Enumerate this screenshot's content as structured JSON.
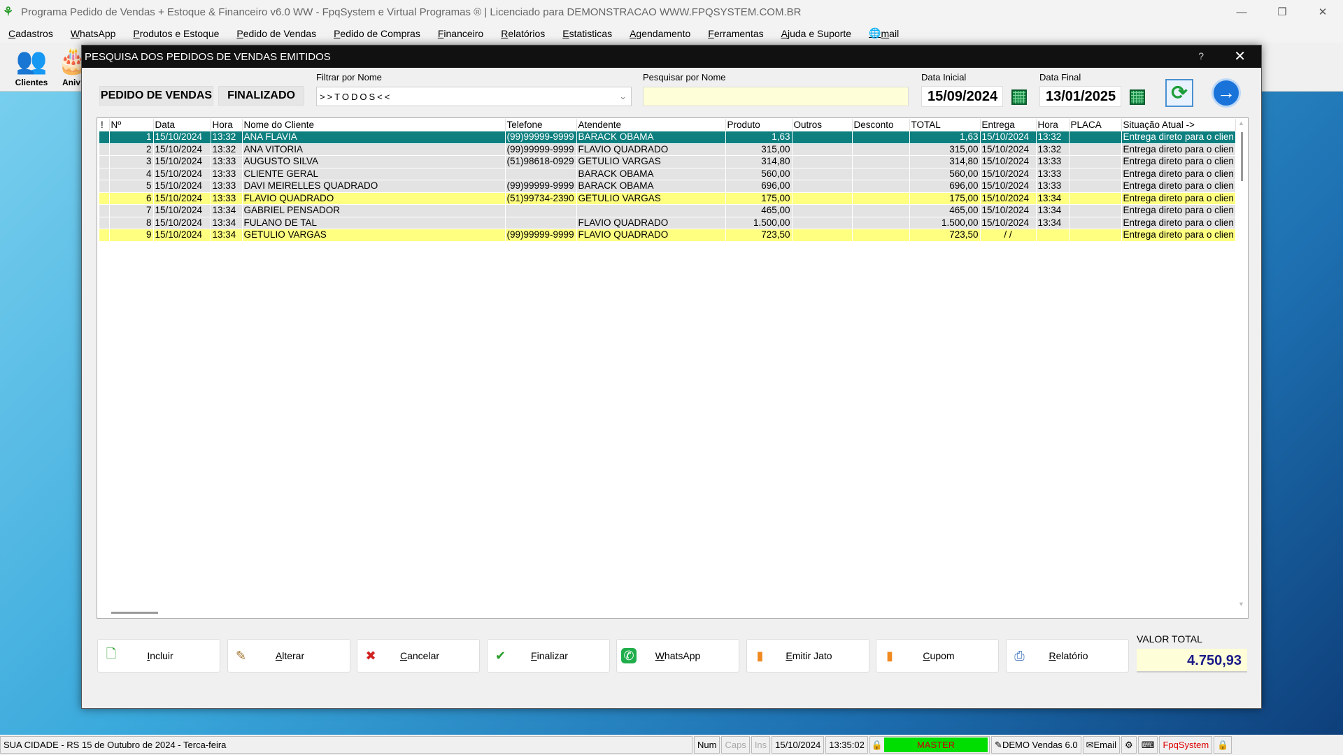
{
  "app": {
    "title": "Programa Pedido de Vendas + Estoque & Financeiro v6.0 WW - FpqSystem e Virtual Programas ® | Licenciado para  DEMONSTRACAO WWW.FPQSYSTEM.COM.BR"
  },
  "menu": [
    "Cadastros",
    "WhatsApp",
    "Produtos e Estoque",
    "Pedido de Vendas",
    "Pedido de Compras",
    "Financeiro",
    "Relatórios",
    "Estatisticas",
    "Agendamento",
    "Ferramentas",
    "Ajuda e Suporte",
    "mail"
  ],
  "toolbar": {
    "clientes": "Clientes",
    "aniversarios": "Aniv"
  },
  "dialog": {
    "title": "PESQUISA DOS PEDIDOS DE VENDAS EMITIDOS",
    "help": "?",
    "tag_pedido": "PEDIDO DE VENDAS",
    "tag_finalizado": "FINALIZADO",
    "filter_label": "Filtrar por Nome",
    "filter_value": ">>TODOS<<",
    "search_label": "Pesquisar por Nome",
    "search_value": "",
    "date_start_label": "Data Inicial",
    "date_start": "15/09/2024",
    "date_end_label": "Data Final",
    "date_end": "13/01/2025",
    "columns": [
      "!",
      "Nº",
      "Data",
      "Hora",
      "Nome do Cliente",
      "Telefone",
      "Atendente",
      "Produto",
      "Outros",
      "Desconto",
      "TOTAL",
      "Entrega",
      "Hora",
      "PLACA",
      "Situação Atual ->"
    ],
    "rows": [
      {
        "n": "1",
        "data": "15/10/2024",
        "hora": "13:32",
        "cliente": "ANA FLAVIA",
        "tel": "(99)99999-9999",
        "atendente": "BARACK OBAMA",
        "produto": "1,63",
        "outros": "",
        "desconto": "",
        "total": "1,63",
        "entrega": "15/10/2024",
        "hora_ent": "13:32",
        "placa": "",
        "situacao": "Entrega direto para o clien",
        "style": "selected"
      },
      {
        "n": "2",
        "data": "15/10/2024",
        "hora": "13:32",
        "cliente": "ANA VITORIA",
        "tel": "(99)99999-9999",
        "atendente": "FLAVIO QUADRADO",
        "produto": "315,00",
        "outros": "",
        "desconto": "",
        "total": "315,00",
        "entrega": "15/10/2024",
        "hora_ent": "13:32",
        "placa": "",
        "situacao": "Entrega direto para o clien",
        "style": "normal"
      },
      {
        "n": "3",
        "data": "15/10/2024",
        "hora": "13:33",
        "cliente": "AUGUSTO SILVA",
        "tel": "(51)98618-0929",
        "atendente": "GETULIO VARGAS",
        "produto": "314,80",
        "outros": "",
        "desconto": "",
        "total": "314,80",
        "entrega": "15/10/2024",
        "hora_ent": "13:33",
        "placa": "",
        "situacao": "Entrega direto para o clien",
        "style": "normal"
      },
      {
        "n": "4",
        "data": "15/10/2024",
        "hora": "13:33",
        "cliente": "CLIENTE GERAL",
        "tel": "",
        "atendente": "BARACK OBAMA",
        "produto": "560,00",
        "outros": "",
        "desconto": "",
        "total": "560,00",
        "entrega": "15/10/2024",
        "hora_ent": "13:33",
        "placa": "",
        "situacao": "Entrega direto para o clien",
        "style": "normal"
      },
      {
        "n": "5",
        "data": "15/10/2024",
        "hora": "13:33",
        "cliente": "DAVI MEIRELLES QUADRADO",
        "tel": "(99)99999-9999",
        "atendente": "BARACK OBAMA",
        "produto": "696,00",
        "outros": "",
        "desconto": "",
        "total": "696,00",
        "entrega": "15/10/2024",
        "hora_ent": "13:33",
        "placa": "",
        "situacao": "Entrega direto para o clien",
        "style": "normal"
      },
      {
        "n": "6",
        "data": "15/10/2024",
        "hora": "13:33",
        "cliente": "FLAVIO QUADRADO",
        "tel": "(51)99734-2390",
        "atendente": "GETULIO VARGAS",
        "produto": "175,00",
        "outros": "",
        "desconto": "",
        "total": "175,00",
        "entrega": "15/10/2024",
        "hora_ent": "13:34",
        "placa": "",
        "situacao": "Entrega direto para o clien",
        "style": "yellow"
      },
      {
        "n": "7",
        "data": "15/10/2024",
        "hora": "13:34",
        "cliente": "GABRIEL PENSADOR",
        "tel": "",
        "atendente": "",
        "produto": "465,00",
        "outros": "",
        "desconto": "",
        "total": "465,00",
        "entrega": "15/10/2024",
        "hora_ent": "13:34",
        "placa": "",
        "situacao": "Entrega direto para o clien",
        "style": "normal"
      },
      {
        "n": "8",
        "data": "15/10/2024",
        "hora": "13:34",
        "cliente": "FULANO DE TAL",
        "tel": "",
        "atendente": "FLAVIO QUADRADO",
        "produto": "1.500,00",
        "outros": "",
        "desconto": "",
        "total": "1.500,00",
        "entrega": "15/10/2024",
        "hora_ent": "13:34",
        "placa": "",
        "situacao": "Entrega direto para o clien",
        "style": "normal"
      },
      {
        "n": "9",
        "data": "15/10/2024",
        "hora": "13:34",
        "cliente": "GETULIO VARGAS",
        "tel": "(99)99999-9999",
        "atendente": "FLAVIO QUADRADO",
        "produto": "723,50",
        "outros": "",
        "desconto": "",
        "total": "723,50",
        "entrega": "  /  /",
        "hora_ent": "",
        "placa": "",
        "situacao": "Entrega direto para o clien",
        "style": "yellow"
      }
    ],
    "buttons": [
      {
        "label": "Incluir",
        "icon": "add-document-icon"
      },
      {
        "label": "Alterar",
        "icon": "edit-pencil-icon"
      },
      {
        "label": "Cancelar",
        "icon": "cancel-document-icon"
      },
      {
        "label": "Finalizar",
        "icon": "check-document-icon"
      },
      {
        "label": "WhatsApp",
        "icon": "whatsapp-icon"
      },
      {
        "label": "Emitir Jato",
        "icon": "print-person-icon"
      },
      {
        "label": "Cupom",
        "icon": "receipt-person-icon"
      },
      {
        "label": "Relatório",
        "icon": "printer-icon"
      }
    ],
    "valor_total_label": "VALOR TOTAL",
    "valor_total": "4.750,93"
  },
  "status": {
    "city": "SUA CIDADE - RS 15 de Outubro de 2024 - Terca-feira",
    "num": "Num",
    "caps": "Caps",
    "ins": "Ins",
    "date": "15/10/2024",
    "time": "13:35:02",
    "user": "MASTER",
    "version": "DEMO Vendas 6.0",
    "email": "Email",
    "brand": "FpqSystem"
  },
  "colors": {
    "selected_row": "#0e7f7f",
    "highlight_row": "#ffff80",
    "user_badge": "#00dd00",
    "total_value": "#1b1b8a"
  }
}
